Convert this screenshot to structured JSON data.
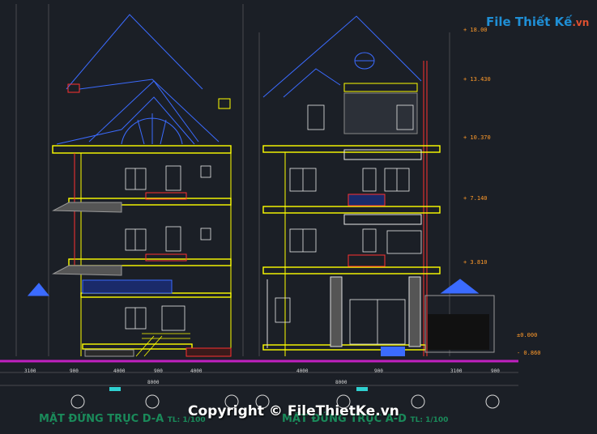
{
  "watermark": {
    "brand": "File Thiết Kế",
    "domain_suffix": ".vn",
    "copyright": "Copyright © FileThietKe.vn"
  },
  "titles": {
    "left": "MẶT ĐỨNG TRỤC D-A",
    "left_scale": "TL: 1/100",
    "right": "MẶT ĐỨNG TRỤC A-D",
    "right_scale": "TL: 1/100"
  },
  "elevations": [
    "+ 18.00",
    "+ 13.430",
    "+ 10.370",
    "+ 7.140",
    "+ 3.810",
    "±0.000",
    "- 0.860"
  ],
  "dimensions_bottom": [
    "3100",
    "900",
    "4000",
    "900",
    "4000",
    "4000",
    "900",
    "3100",
    "900"
  ],
  "dimensions_total": [
    "8000",
    "8000"
  ],
  "colors": {
    "background": "#1b1f26",
    "structure": "#ffff00",
    "roof": "#3b6bff",
    "accent": "#ff3030",
    "ground": "#c020c0"
  }
}
